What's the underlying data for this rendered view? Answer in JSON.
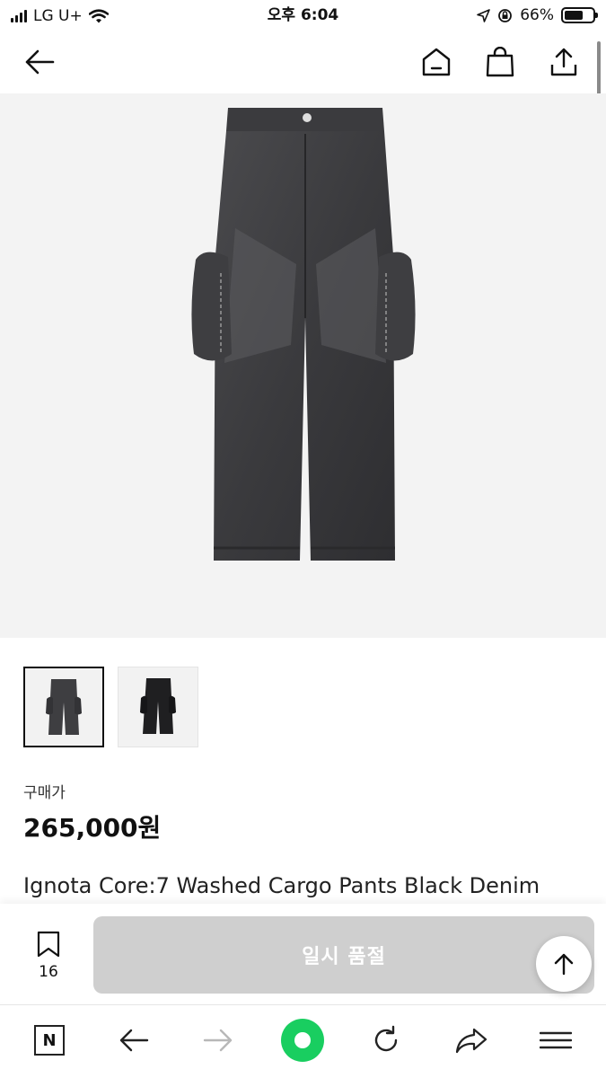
{
  "status_bar": {
    "carrier": "LG U+",
    "time": "오후 6:04",
    "battery_percent": "66%",
    "battery_level": 0.66
  },
  "header": {
    "icons": [
      "back-arrow-icon",
      "home-icon",
      "shopping-bag-icon",
      "share-icon"
    ]
  },
  "product": {
    "price_label": "구매가",
    "price": "265,000원",
    "name": "Ignota Core:7 Washed Cargo Pants Black Denim"
  },
  "action_bar": {
    "bookmark_count": "16",
    "soldout_label": "일시 품절"
  },
  "browser_bar": {
    "n_label": "N",
    "icons": [
      "naver-n-icon",
      "back-icon",
      "forward-icon",
      "green-home-icon",
      "refresh-icon",
      "share-icon",
      "menu-icon"
    ]
  },
  "colors": {
    "soldout_button": "#cfcfcf",
    "hero_background": "#f3f3f3",
    "green_button": "#19ce60"
  }
}
